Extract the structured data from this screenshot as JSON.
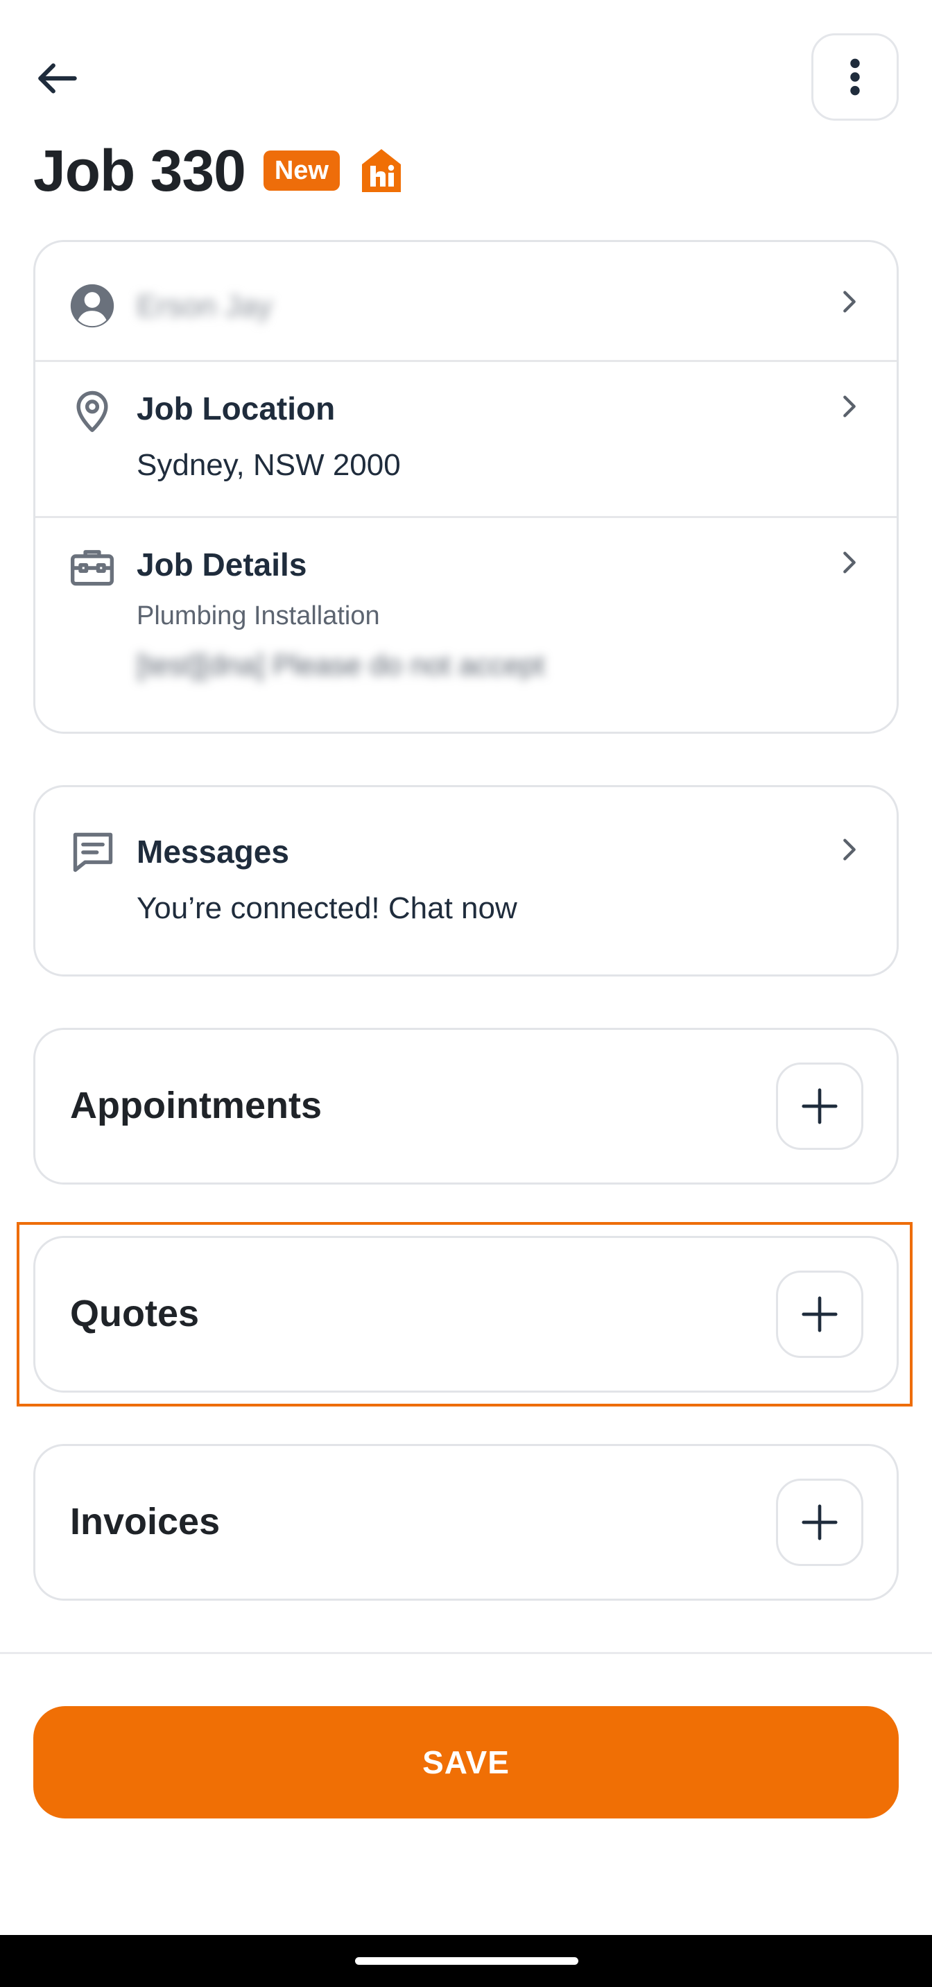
{
  "header": {
    "back_icon": "arrow-left-icon",
    "more_icon": "more-vertical-icon",
    "title": "Job 330",
    "badge": "New",
    "brand_logo": "hi"
  },
  "job_card": {
    "customer": {
      "icon": "person-icon",
      "name": "Erson Jay"
    },
    "location": {
      "icon": "map-pin-icon",
      "title": "Job Location",
      "value": "Sydney, NSW 2000"
    },
    "details": {
      "icon": "toolbox-icon",
      "title": "Job Details",
      "category": "Plumbing Installation",
      "note": "[test][dna] Please do not accept"
    }
  },
  "messages": {
    "icon": "chat-icon",
    "title": "Messages",
    "subtitle": "You’re connected! Chat now"
  },
  "sections": {
    "appointments": "Appointments",
    "quotes": "Quotes",
    "invoices": "Invoices"
  },
  "footer": {
    "save_label": "SAVE"
  },
  "colors": {
    "accent": "#F06F05",
    "border": "#E2E4E8",
    "text": "#1F2328"
  }
}
